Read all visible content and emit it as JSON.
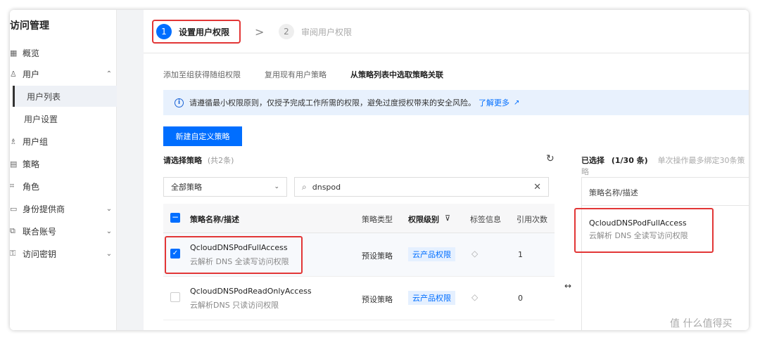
{
  "sidebar": {
    "title": "访问管理",
    "items": [
      {
        "icon": "grid-icon",
        "label": "概览",
        "chevron": ""
      },
      {
        "icon": "user-icon",
        "label": "用户",
        "chevron": "⌃"
      },
      {
        "icon": "user-group-icon",
        "label": "用户组",
        "chevron": ""
      },
      {
        "icon": "policy-icon",
        "label": "策略",
        "chevron": ""
      },
      {
        "icon": "role-icon",
        "label": "角色",
        "chevron": ""
      },
      {
        "icon": "identity-provider-icon",
        "label": "身份提供商",
        "chevron": "⌄"
      },
      {
        "icon": "federated-account-icon",
        "label": "联合账号",
        "chevron": "⌄"
      },
      {
        "icon": "key-icon",
        "label": "访问密钥",
        "chevron": "⌄"
      }
    ],
    "sub_items": [
      {
        "label": "用户列表",
        "active": true
      },
      {
        "label": "用户设置",
        "active": false
      }
    ]
  },
  "steps": [
    {
      "num": "1",
      "label": "设置用户权限",
      "active": true
    },
    {
      "num": "2",
      "label": "审阅用户权限",
      "active": false
    }
  ],
  "step_separator": ">",
  "tabs": [
    {
      "label": "添加至组获得随组权限",
      "active": false
    },
    {
      "label": "复用现有用户策略",
      "active": false
    },
    {
      "label": "从策略列表中选取策略关联",
      "active": true
    }
  ],
  "info": {
    "icon": "info-icon",
    "text": "请遵循最小权限原则，仅授予完成工作所需的权限，避免过度授权带来的安全风险。",
    "link": "了解更多",
    "link_icon": "external-link-icon"
  },
  "new_policy_button": "新建自定义策略",
  "select_section": {
    "label": "请选择策略",
    "count": "(共2条)"
  },
  "filter": {
    "dropdown_value": "全部策略",
    "search_value": "dnspod"
  },
  "table": {
    "columns": [
      "策略名称/描述",
      "策略类型",
      "权限级别",
      "标签信息",
      "引用次数"
    ],
    "rows": [
      {
        "name": "QcloudDNSPodFullAccess",
        "desc": "云解析 DNS 全读写访问权限",
        "type": "预设策略",
        "level": "云产品权限",
        "refs": "1",
        "checked": true
      },
      {
        "name": "QcloudDNSPodReadOnlyAccess",
        "desc": "云解析DNS 只读访问权限",
        "type": "预设策略",
        "level": "云产品权限",
        "refs": "0",
        "checked": false
      }
    ]
  },
  "selected_section": {
    "label": "已选择",
    "count": "(1/30 条)",
    "note": "单次操作最多绑定30条策略",
    "column": "策略名称/描述",
    "item_name": "QcloudDNSPodFullAccess",
    "item_desc": "云解析 DNS 全读写访问权限"
  },
  "watermark": "值 什么值得买",
  "colors": {
    "accent": "#006eff",
    "highlight": "#e23636"
  }
}
